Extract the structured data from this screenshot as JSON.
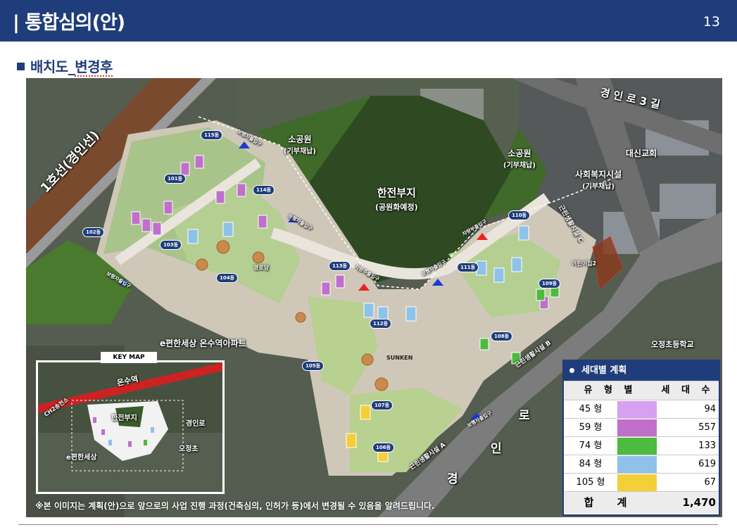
{
  "header": {
    "title": "| 통합심의(안)",
    "page_number": "13"
  },
  "section": {
    "title_prefix": "배치도_",
    "title_underlined": "변경후"
  },
  "map_labels": {
    "line1": "1호선(경인선)",
    "road_kyungin3": "경 인 로   3 길",
    "road_kyungin": [
      "경",
      "인",
      "로"
    ],
    "park1": "소공원",
    "park1_sub": "(기부채납)",
    "park2": "소공원",
    "park2_sub": "(기부채납)",
    "school_site": "한전부지",
    "school_sub": "(공원화예정)",
    "church": "대신교회",
    "welfare": "사회복지시설",
    "welfare_sub": "(기부채납)",
    "apt": "e편한세상 온수역아파트",
    "elementary": "오정초등학교",
    "ped1": "보행자출입구",
    "ped2": "보행자출입구",
    "ped3": "보행자출입구",
    "ped4": "보행자출입구",
    "ped5": "보행자출입구",
    "car1": "차량주출입구",
    "car2": "차량부출입구",
    "community": "경로당",
    "nursery": "어린이집2",
    "sunken": "SUNKEN",
    "facility_a": "근린생활시설 A",
    "facility_b": "근린생활시설 B",
    "facility_c": "근린생활시설 C"
  },
  "buildings": [
    "101동",
    "102동",
    "103동",
    "104동",
    "105동",
    "106동",
    "107동",
    "108동",
    "109동",
    "110동",
    "111동",
    "112동",
    "113동",
    "114동",
    "115동"
  ],
  "keymap": {
    "title": "KEY MAP",
    "onsu": "온수역",
    "line": "CH2송전소",
    "site": "한전부지",
    "kyungin": "경인로",
    "ochang": "오정초",
    "apt": "e편한세상"
  },
  "notice": "※본 이미지는 계획(안)으로 앞으로의 사업 진행 과정(건축심의, 인허가 등)에서 변경될 수 있음을 알려드립니다.",
  "unit_table": {
    "title": "세대별 계획",
    "col_type": "유 형 별",
    "col_count": "세 대 수",
    "rows": [
      {
        "type": "45 형",
        "color": "#d8a0f0",
        "count": "94"
      },
      {
        "type": "59 형",
        "color": "#c070cc",
        "count": "557"
      },
      {
        "type": "74 형",
        "color": "#4dbb3f",
        "count": "133"
      },
      {
        "type": "84 형",
        "color": "#8ec2e8",
        "count": "619"
      },
      {
        "type": "105 형",
        "color": "#f4cf3a",
        "count": "67"
      }
    ],
    "total_label": "합 계",
    "total_count": "1,470"
  }
}
